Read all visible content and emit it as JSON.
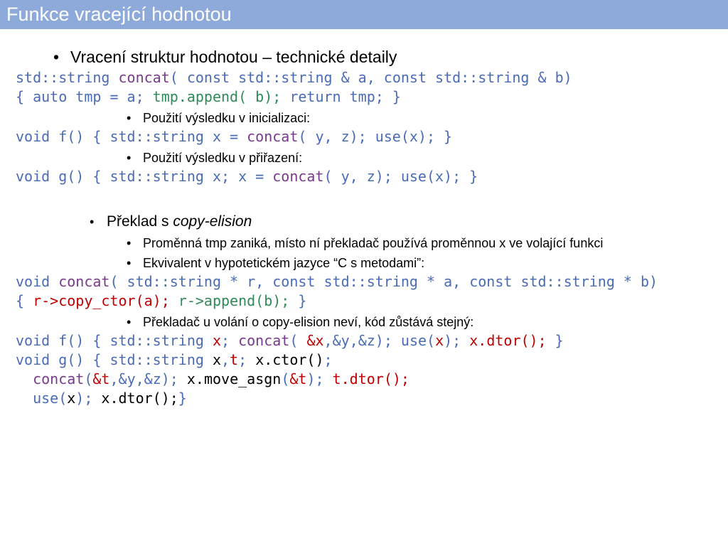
{
  "header": {
    "title": "Funkce vracející hodnotou"
  },
  "main": {
    "heading": "Vracení struktur hodnotou – technické detaily",
    "sub_init": "Použití výsledku v inicializaci:",
    "sub_assign": "Použití výsledku v přiřazení:",
    "translation": {
      "prefix": "Překlad s ",
      "emph": "copy-elision"
    },
    "sub_tmp": "Proměnná tmp zaniká, místo ní překladač používá proměnnou x ve volající funkci",
    "sub_equiv": "Ekvivalent v hypotetickém jazyce “C s metodami”:",
    "sub_unaware": "Překladač u volání o copy-elision neví, kód zůstává stejný:"
  },
  "code": {
    "l1": [
      "std::string ",
      "concat",
      "( const std::string & a, const std::string & b)"
    ],
    "l2": [
      "{ auto tmp = a; ",
      "tmp.append( b);",
      " return tmp; }"
    ],
    "l3": [
      "void f() { std::string x = ",
      "concat",
      "( y, z); use(x); }"
    ],
    "l4": [
      "void g() { std::string x; x = ",
      "concat",
      "( y, z); use(x); }"
    ],
    "l5": [
      "void ",
      "concat",
      "( std::string * r, const std::string * a, const std::string * b)"
    ],
    "l6": [
      "{ ",
      "r->copy_ctor(a);",
      " ",
      "r->append(b);",
      " }"
    ],
    "l7": [
      "void f() { std::string ",
      "x",
      "; ",
      "concat",
      "( ",
      "&x",
      ",&y,&z); use(",
      "x",
      "); ",
      "x.dtor();",
      " }"
    ],
    "l8": [
      "void g() { std::string ",
      "x",
      ",",
      "t",
      "; ",
      "x.ctor()",
      ";"
    ],
    "l9": [
      "  ",
      "concat",
      "(",
      "&t",
      ",&y,&z); ",
      "x.move_asgn",
      "(",
      "&t",
      "); ",
      "t.dtor();"
    ],
    "l10": [
      "  use(",
      "x",
      "); ",
      "x.dtor();",
      "}"
    ]
  }
}
